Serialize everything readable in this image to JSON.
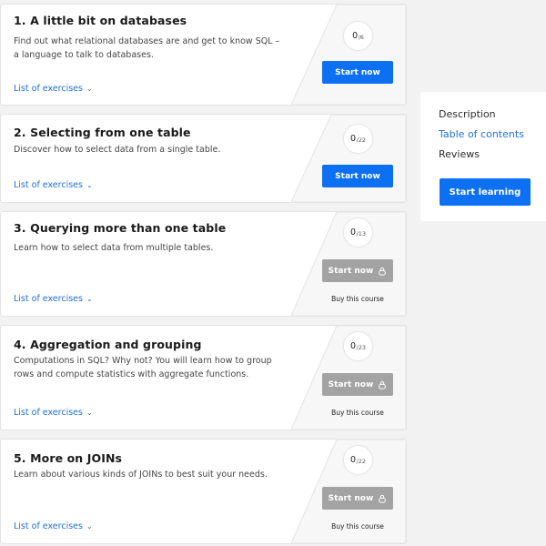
{
  "chapters": [
    {
      "title": "1. A little bit on databases",
      "description": "Find out what relational databases are and get to know SQL – a language to talk to databases.",
      "progress_done": "0",
      "progress_total": "/6",
      "list_label": "List of exercises",
      "button_label": "Start now",
      "locked": false,
      "buy_label": ""
    },
    {
      "title": "2. Selecting from one table",
      "description": "Discover how to select data from a single table.",
      "progress_done": "0",
      "progress_total": "/22",
      "list_label": "List of exercises",
      "button_label": "Start now",
      "locked": false,
      "buy_label": ""
    },
    {
      "title": "3. Querying more than one table",
      "description": "Learn how to select data from multiple tables.",
      "progress_done": "0",
      "progress_total": "/13",
      "list_label": "List of exercises",
      "button_label": "Start now",
      "locked": true,
      "buy_label": "Buy this course"
    },
    {
      "title": "4. Aggregation and grouping",
      "description": "Computations in SQL? Why not? You will learn how to group rows and compute statistics with aggregate functions.",
      "progress_done": "0",
      "progress_total": "/23",
      "list_label": "List of exercises",
      "button_label": "Start now",
      "locked": true,
      "buy_label": "Buy this course"
    },
    {
      "title": "5. More on JOINs",
      "description": "Learn about various kinds of JOINs to best suit your needs.",
      "progress_done": "0",
      "progress_total": "/22",
      "list_label": "List of exercises",
      "button_label": "Start now",
      "locked": true,
      "buy_label": "Buy this course"
    }
  ],
  "sidebar": {
    "items": [
      {
        "label": "Description",
        "active": false
      },
      {
        "label": "Table of contents",
        "active": true
      },
      {
        "label": "Reviews",
        "active": false
      }
    ],
    "cta_label": "Start learning"
  },
  "colors": {
    "accent": "#0d6ff2",
    "link": "#1f6fd6",
    "locked_button": "#a3a3a3"
  },
  "icons": {
    "chevron": "chevron-down-icon",
    "lock": "lock-icon"
  }
}
